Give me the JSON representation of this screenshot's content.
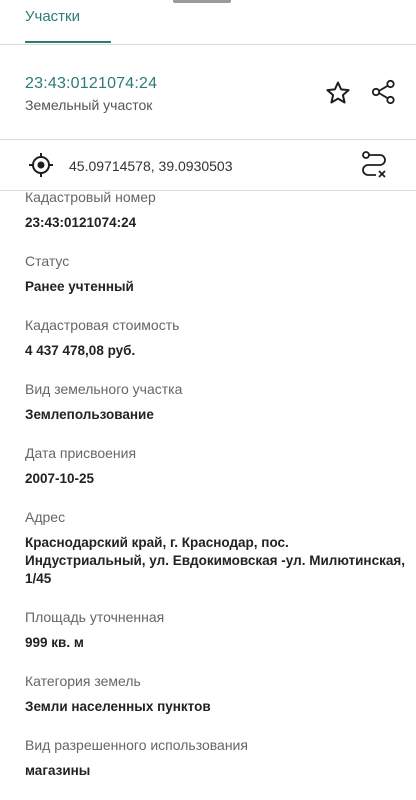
{
  "tabs": {
    "active_label": "Участки"
  },
  "header": {
    "title": "23:43:0121074:24",
    "subtitle": "Земельный участок",
    "icons": {
      "favorite": "star-icon",
      "share": "share-icon"
    }
  },
  "location": {
    "coordinates": "45.09714578, 39.0930503",
    "icons": {
      "locate": "target-icon",
      "route": "route-icon"
    }
  },
  "fields": [
    {
      "label": "Кадастровый номер",
      "value": "23:43:0121074:24"
    },
    {
      "label": "Статус",
      "value": "Ранее учтенный"
    },
    {
      "label": "Кадастровая стоимость",
      "value": "4 437 478,08 руб."
    },
    {
      "label": "Вид земельного участка",
      "value": "Землепользование"
    },
    {
      "label": "Дата присвоения",
      "value": "2007-10-25"
    },
    {
      "label": "Адрес",
      "value": "Краснодарский край, г. Краснодар, пос. Индустриальный, ул. Евдокимовская -ул. Милютинская, 1/45"
    },
    {
      "label": "Площадь уточненная",
      "value": "999 кв. м"
    },
    {
      "label": "Категория земель",
      "value": "Земли населенных пунктов"
    },
    {
      "label": "Вид разрешенного использования",
      "value": "магазины"
    }
  ],
  "colors": {
    "accent": "#2b7c79",
    "divider": "#dcdcdc"
  }
}
